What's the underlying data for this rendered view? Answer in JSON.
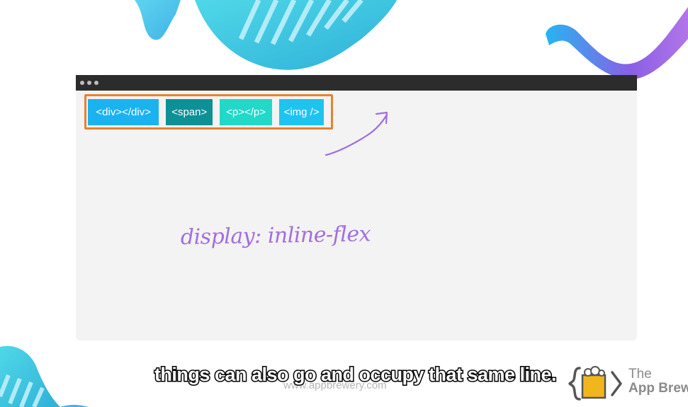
{
  "elements": [
    {
      "label": "<div></div>",
      "color": "#1ab3ef"
    },
    {
      "label": "<span>",
      "color": "#0e9097"
    },
    {
      "label": "<p></p>",
      "color": "#22d8c9"
    },
    {
      "label": "<img />",
      "color": "#1fc3ef"
    }
  ],
  "annotation": {
    "handwritten_text": "display: inline-flex",
    "arrow_color": "#a26ee0"
  },
  "subtitle": "things can also go and occupy that same line.",
  "watermark": "www.appbrewery.com",
  "brand": {
    "line1": "The",
    "line2": "App Brew"
  },
  "colors": {
    "container_border": "#e8822c",
    "titlebar": "#2c2c2c",
    "browser_bg": "#f3f3f3"
  }
}
